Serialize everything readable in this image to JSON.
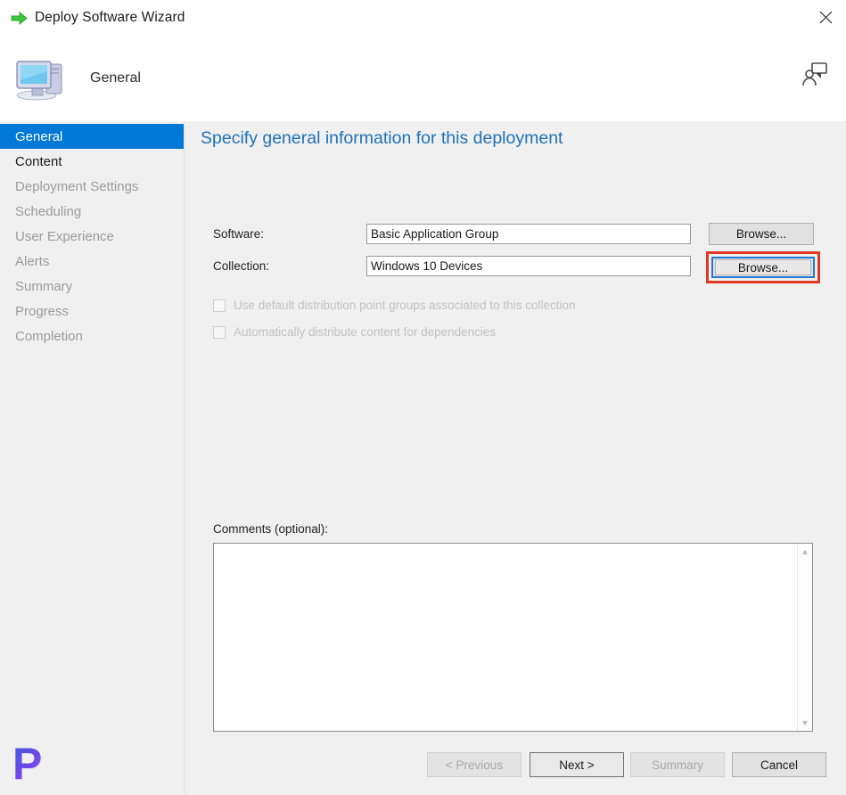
{
  "window": {
    "title": "Deploy Software Wizard",
    "title_icon": "green-arrow-icon",
    "close_icon": "close-icon"
  },
  "header": {
    "title": "General",
    "icon": "computer-icon",
    "help_icon": "help-person-icon"
  },
  "sidebar": {
    "items": [
      {
        "label": "General",
        "state": "selected"
      },
      {
        "label": "Content",
        "state": "active"
      },
      {
        "label": "Deployment Settings",
        "state": "disabled"
      },
      {
        "label": "Scheduling",
        "state": "disabled"
      },
      {
        "label": "User Experience",
        "state": "disabled"
      },
      {
        "label": "Alerts",
        "state": "disabled"
      },
      {
        "label": "Summary",
        "state": "disabled"
      },
      {
        "label": "Progress",
        "state": "disabled"
      },
      {
        "label": "Completion",
        "state": "disabled"
      }
    ]
  },
  "main": {
    "heading": "Specify general information for this deployment",
    "fields": {
      "software_label": "Software:",
      "software_value": "Basic Application Group",
      "collection_label": "Collection:",
      "collection_value": "Windows 10 Devices",
      "browse_software_label": "Browse...",
      "browse_collection_label": "Browse..."
    },
    "checkboxes": [
      {
        "label": "Use default distribution point groups associated to this collection",
        "checked": false,
        "enabled": false
      },
      {
        "label": "Automatically distribute content for dependencies",
        "checked": false,
        "enabled": false
      }
    ],
    "comments_label": "Comments (optional):",
    "comments_value": "",
    "comments_placeholder": ""
  },
  "footer": {
    "previous_label": "< Previous",
    "next_label": "Next >",
    "summary_label": "Summary",
    "cancel_label": "Cancel"
  },
  "annotation": {
    "highlight_color": "#e03a23",
    "focus_color": "#2079d2",
    "target": "browse_collection_button"
  },
  "colors": {
    "accent": "#0078d7",
    "heading": "#2072b8",
    "background": "#f0f0f0"
  },
  "watermark": {
    "letter": "P"
  }
}
